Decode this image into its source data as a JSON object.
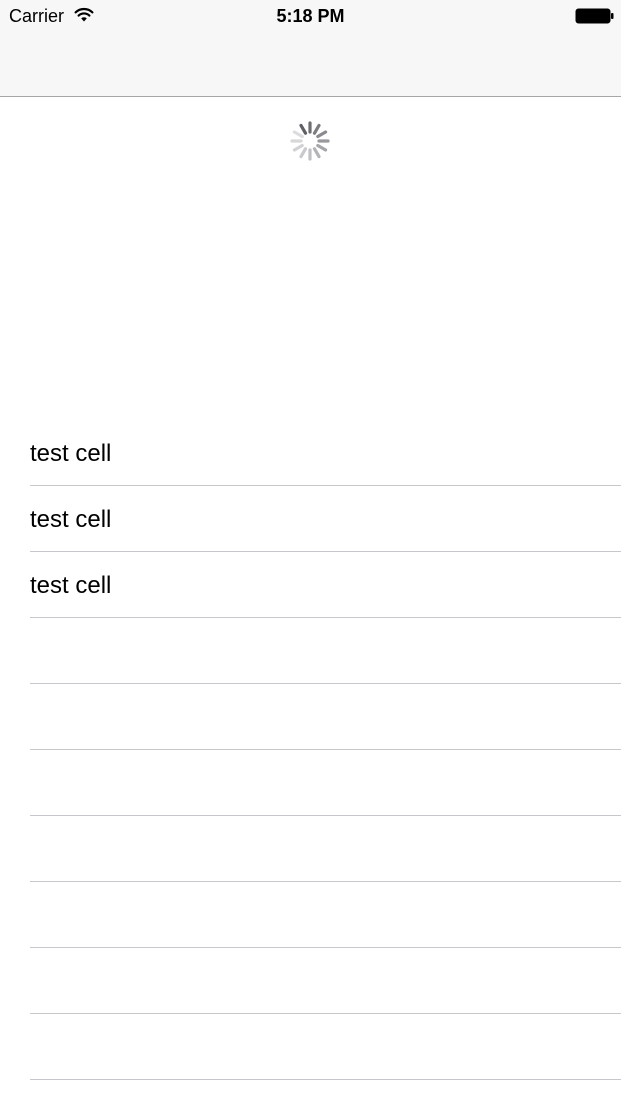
{
  "status_bar": {
    "carrier": "Carrier",
    "time": "5:18 PM",
    "wifi_icon": "wifi-icon",
    "battery_icon": "battery-icon"
  },
  "loading_indicator": {
    "icon": "activity-spinner-icon"
  },
  "table": {
    "rows": [
      {
        "label": "test cell"
      },
      {
        "label": "test cell"
      },
      {
        "label": "test cell"
      },
      {
        "label": ""
      },
      {
        "label": ""
      },
      {
        "label": ""
      },
      {
        "label": ""
      },
      {
        "label": ""
      },
      {
        "label": ""
      },
      {
        "label": ""
      }
    ]
  },
  "colors": {
    "navbar_background": "#f7f7f7",
    "navbar_border": "#a7a7aa",
    "separator": "#c8c7cc"
  }
}
